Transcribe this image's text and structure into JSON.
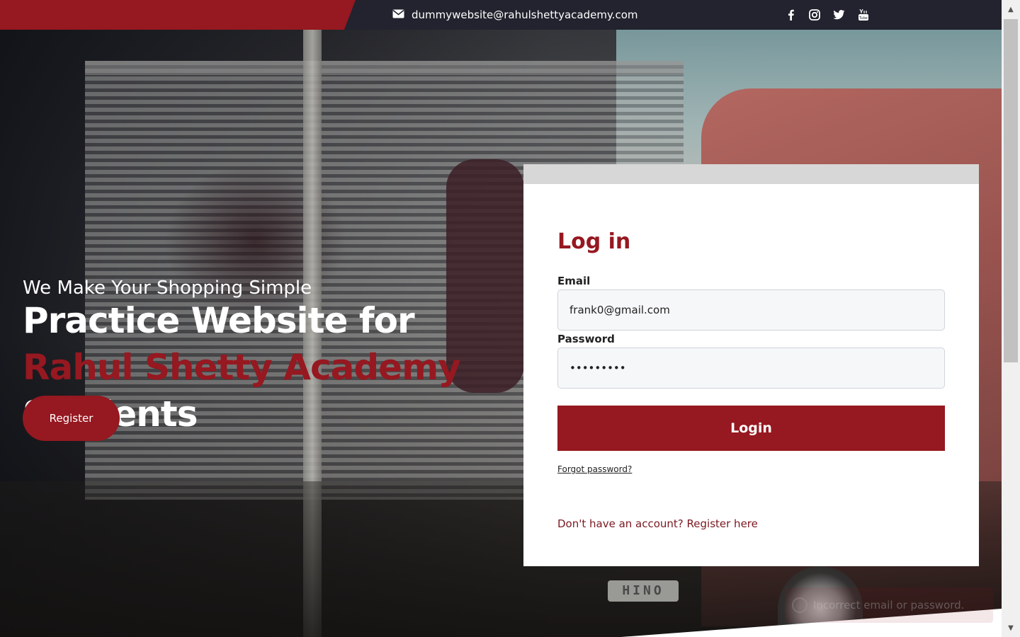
{
  "topbar": {
    "email": "dummywebsite@rahulshettyacademy.com",
    "email_icon": "envelope-icon",
    "social_icons": [
      "facebook-icon",
      "instagram-icon",
      "twitter-icon",
      "youtube-icon"
    ],
    "brand_color": "#961820",
    "bar_color": "#22232e"
  },
  "hero": {
    "tagline": "We Make Your Shopping Simple",
    "headline_part1": "Practice Website for ",
    "headline_accent": "Rahul Shetty Academy",
    "headline_part2": " Students",
    "register_button": "Register"
  },
  "login": {
    "title": "Log in",
    "email_label": "Email",
    "email_value": "frank0@gmail.com",
    "password_label": "Password",
    "password_value": "hidden123",
    "login_button": "Login",
    "forgot_password": "Forgot password?",
    "register_link": "Don't have an account? Register here"
  },
  "toast": {
    "message": "Incorrect email or password."
  },
  "background": {
    "truck_badge": "HINO"
  }
}
